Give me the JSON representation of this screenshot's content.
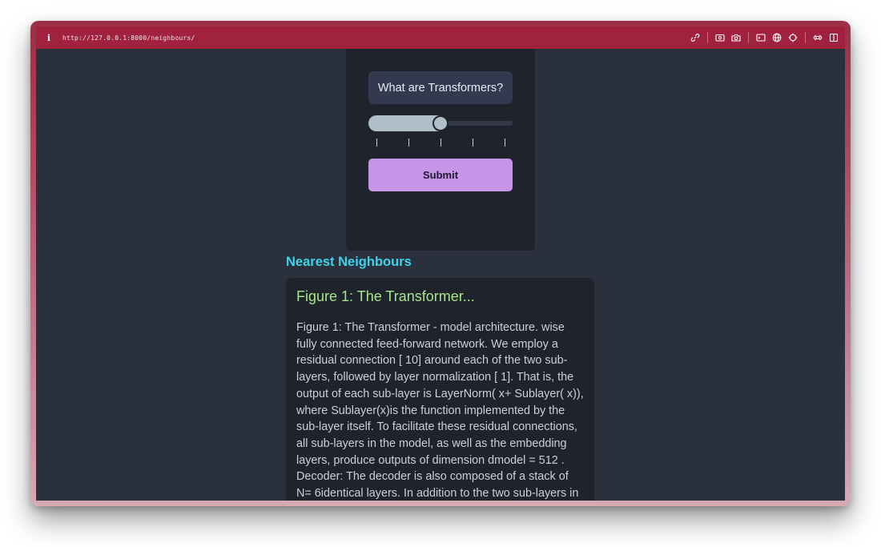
{
  "browser": {
    "url": "http://127.0.0.1:8000/neighbours/",
    "toolbar_icons": [
      "link-icon",
      "screenshot-icon",
      "camera-icon",
      "terminal-icon",
      "globe-icon",
      "crosshair-icon",
      "responsive-icon",
      "sidebar-icon"
    ]
  },
  "form": {
    "query_value": "What are Transformers?",
    "slider": {
      "value": 3,
      "min": 1,
      "max": 5,
      "ticks": 5
    },
    "submit_label": "Submit"
  },
  "results": {
    "heading": "Nearest Neighbours",
    "items": [
      {
        "title": "Figure 1: The Transformer...",
        "body": "Figure 1: The Transformer - model architecture. wise fully connected feed-forward network. We employ a residual connection [ 10] around each of the two sub-layers, followed by layer normalization [ 1]. That is, the output of each sub-layer is LayerNorm( x+ Sublayer( x)), where Sublayer(x)is the function implemented by the sub-layer itself. To facilitate these residual connections, all sub-layers in the model, as well as the embedding layers, produce outputs of dimension dmodel = 512 . Decoder: The decoder is also composed of a stack of N= 6identical layers. In addition to the two sub-layers in each"
      }
    ]
  },
  "colors": {
    "titlebar": "#a0223e",
    "page_bg": "#2a303c",
    "card_bg": "#1f232c",
    "accent_heading": "#3dd4e9",
    "result_title": "#a6e58a",
    "submit_bg": "#c695e8"
  }
}
